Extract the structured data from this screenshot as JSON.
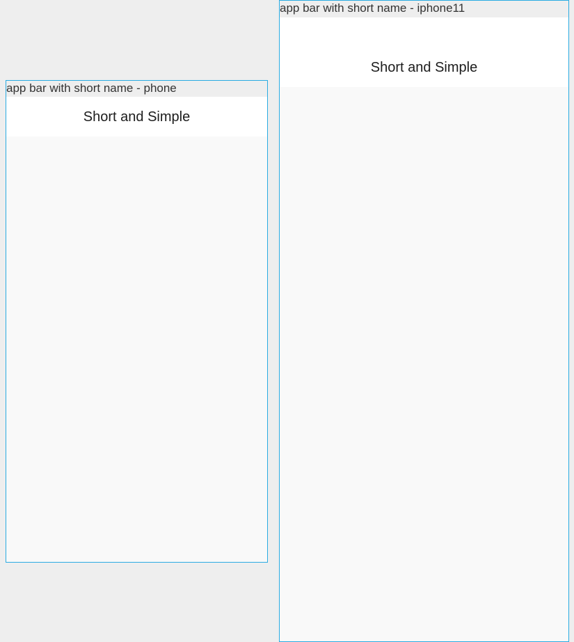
{
  "devices": {
    "phone": {
      "label": "app bar with short name - phone",
      "app_bar_title": "Short and Simple"
    },
    "iphone11": {
      "label": "app bar with short name - iphone11",
      "app_bar_title": "Short and Simple"
    }
  },
  "colors": {
    "background": "#eeeeee",
    "device_border": "#29abe2",
    "app_bar": "#ffffff",
    "screen": "#f9f9f9"
  }
}
